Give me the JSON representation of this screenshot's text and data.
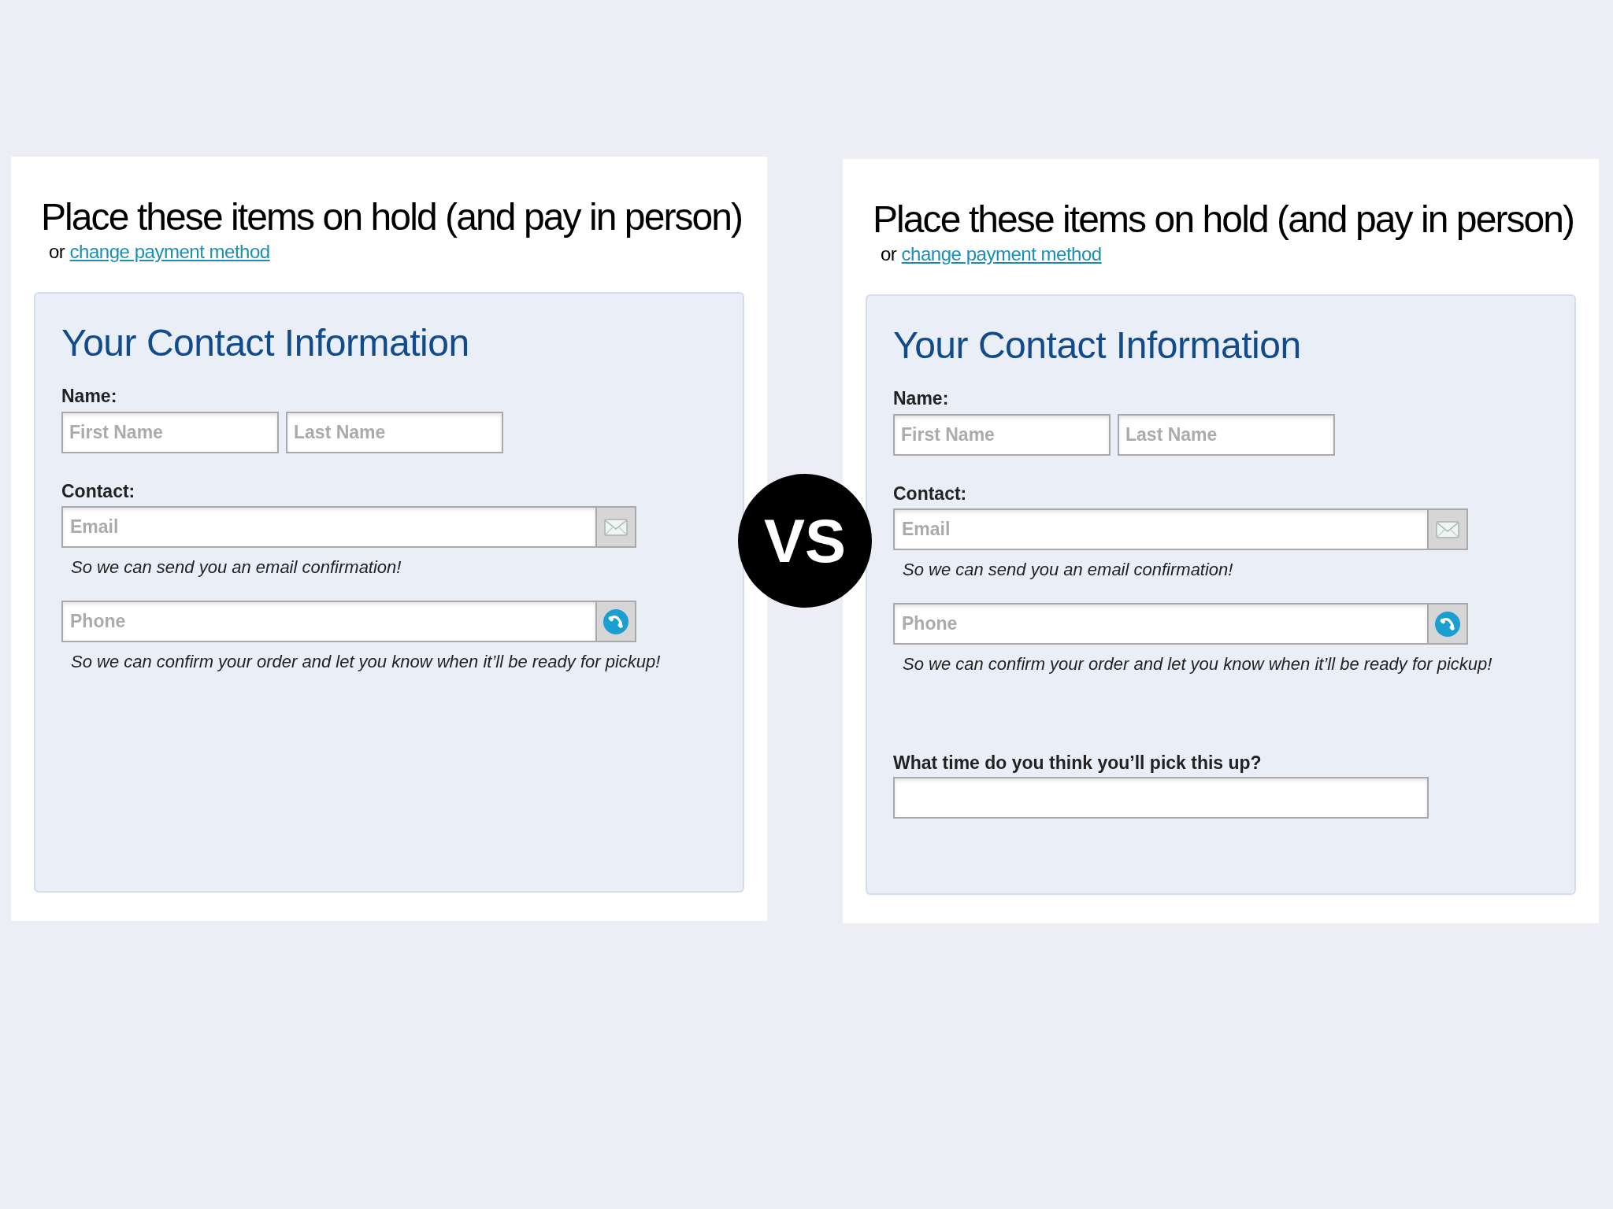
{
  "panels": [
    {
      "title": "Place these items on hold (and pay in person)",
      "alternative": {
        "prefix": "or",
        "link": "change payment method"
      },
      "form": {
        "heading": "Your Contact Information",
        "name": {
          "label": "Name:",
          "fields": [
            {
              "placeholder": "First Name"
            },
            {
              "placeholder": "Last Name"
            }
          ]
        },
        "contact": {
          "label": "Contact:",
          "fields": [
            {
              "kind": "email",
              "placeholder": "Email",
              "hint": "So we can send you an email confirmation!"
            },
            {
              "kind": "phone",
              "placeholder": "Phone",
              "hint": "So we can confirm your order and let you know when it’ll be ready for pickup!"
            }
          ]
        }
      }
    },
    {
      "title": "Place these items on hold (and pay in person)",
      "alternative": {
        "prefix": "or",
        "link": "change payment method"
      },
      "form": {
        "heading": "Your Contact Information",
        "name": {
          "label": "Name:",
          "fields": [
            {
              "placeholder": "First Name"
            },
            {
              "placeholder": "Last Name"
            }
          ]
        },
        "contact": {
          "label": "Contact:",
          "fields": [
            {
              "kind": "email",
              "placeholder": "Email",
              "hint": "So we can send you an email confirmation!"
            },
            {
              "kind": "phone",
              "placeholder": "Phone",
              "hint": "So we can confirm your order and let you know when it’ll be ready for pickup!"
            }
          ]
        },
        "pickup_time": {
          "label": "What time do you think you’ll pick this up?"
        }
      }
    }
  ],
  "separator": {
    "label": "VS"
  }
}
